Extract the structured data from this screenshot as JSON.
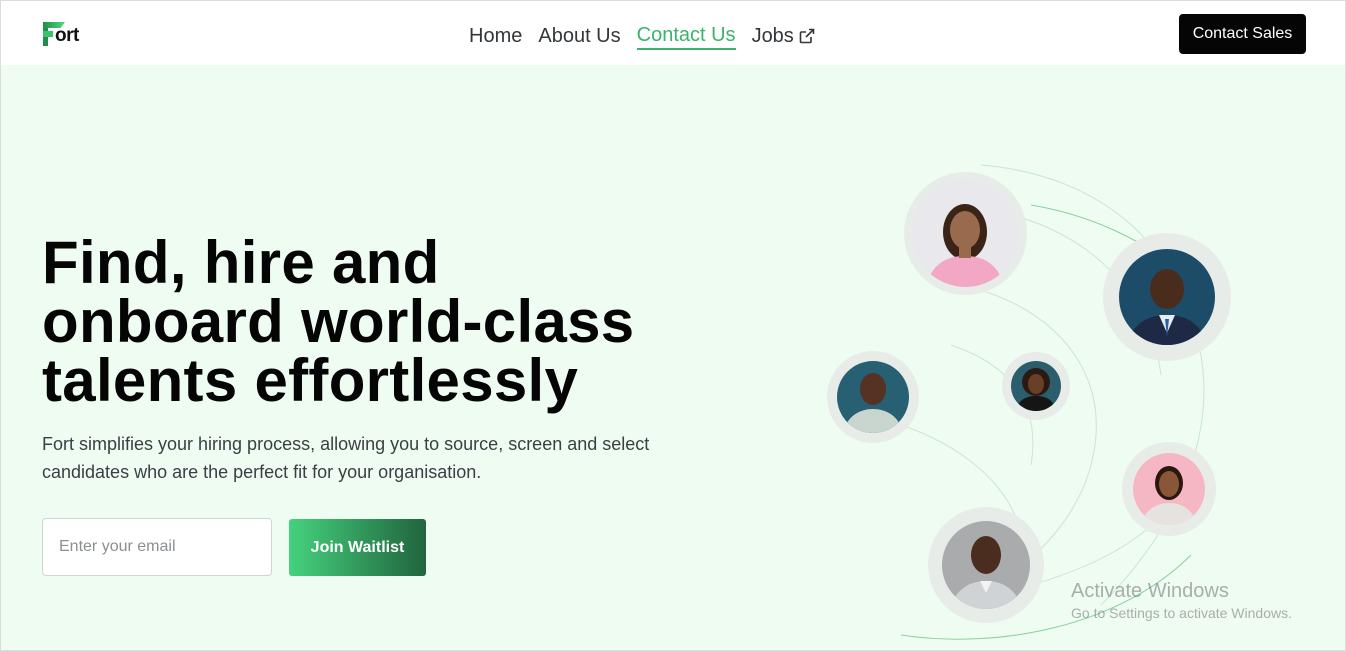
{
  "brand": {
    "name": "ort"
  },
  "nav": {
    "items": [
      {
        "label": "Home"
      },
      {
        "label": "About Us"
      },
      {
        "label": "Contact Us"
      },
      {
        "label": "Jobs"
      }
    ]
  },
  "header": {
    "cta_label": "Contact Sales"
  },
  "hero": {
    "headline_line1": "Find, hire and",
    "headline_line2": "onboard world-class",
    "headline_line3": "talents effortlessly",
    "subtext_line1": "Fort simplifies your hiring process, allowing you to source, screen and select",
    "subtext_line2": "candidates who are the perfect fit for your organisation.",
    "email_placeholder": "Enter your email",
    "join_label": "Join Waitlist"
  },
  "watermark": {
    "title": "Activate Windows",
    "subtitle": "Go to Settings to activate Windows."
  },
  "colors": {
    "accent": "#3bb36a",
    "hero_bg": "#effcf2",
    "cta_bg": "#050505"
  }
}
